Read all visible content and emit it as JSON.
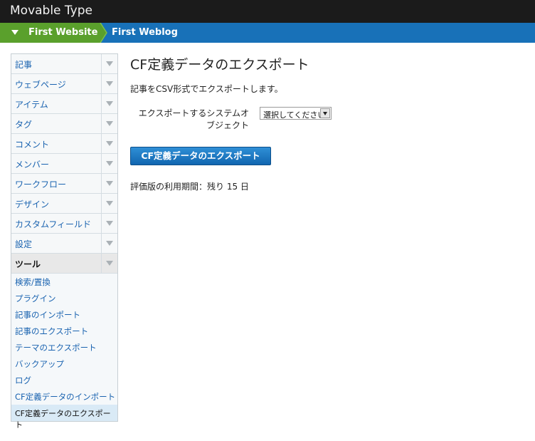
{
  "app": {
    "title": "Movable Type"
  },
  "sitebar": {
    "website": "First Website",
    "blog": "First Weblog"
  },
  "menu": {
    "items": [
      {
        "label": "記事"
      },
      {
        "label": "ウェブページ"
      },
      {
        "label": "アイテム"
      },
      {
        "label": "タグ"
      },
      {
        "label": "コメント"
      },
      {
        "label": "メンバー"
      },
      {
        "label": "ワークフロー"
      },
      {
        "label": "デザイン"
      },
      {
        "label": "カスタムフィールド"
      },
      {
        "label": "設定"
      }
    ],
    "active": {
      "label": "ツール"
    },
    "subitems": [
      {
        "label": "検索/置換"
      },
      {
        "label": "プラグイン"
      },
      {
        "label": "記事のインポート"
      },
      {
        "label": "記事のエクスポート"
      },
      {
        "label": "テーマのエクスポート"
      },
      {
        "label": "バックアップ"
      },
      {
        "label": "ログ"
      },
      {
        "label": "CF定義データのインポート"
      },
      {
        "label": "CF定義データのエクスポート"
      }
    ]
  },
  "main": {
    "title": "CF定義データのエクスポート",
    "description": "記事をCSV形式でエクスポートします。",
    "field_label": "エクスポートするシステムオブジェクト",
    "select_value": "選択してください",
    "button_label": "CF定義データのエクスポート",
    "trial_text": "評価版の利用期間：残り 15 日"
  },
  "colors": {
    "header_bg": "#1b1b1b",
    "sitebar_bg": "#1871b8",
    "website_crumb_bg": "#5aa02c",
    "link": "#1a63b0",
    "button_bg": "#1871b8"
  },
  "icons": {
    "website_toggle": "triangle-down-icon",
    "menu_toggle": "chevron-down-icon",
    "select_arrow": "dropdown-arrow-icon"
  }
}
